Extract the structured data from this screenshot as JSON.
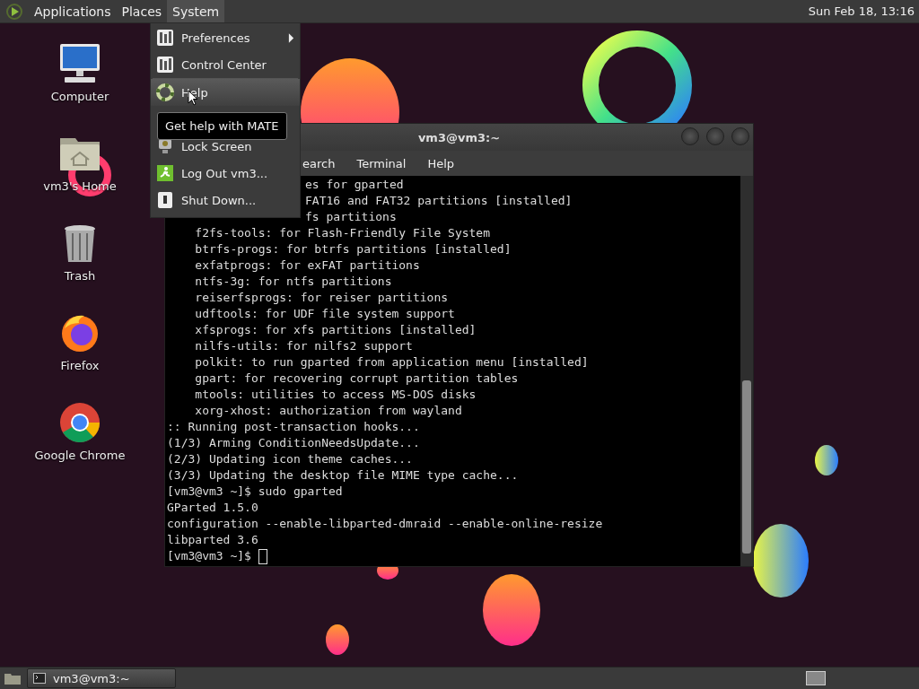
{
  "top_panel": {
    "menus": [
      {
        "label": "Applications",
        "selected": false
      },
      {
        "label": "Places",
        "selected": false
      },
      {
        "label": "System",
        "selected": true
      }
    ],
    "clock": "Sun Feb 18, 13:16"
  },
  "desktop_icons": [
    {
      "kind": "computer",
      "label": "Computer"
    },
    {
      "kind": "home",
      "label": "vm3's Home"
    },
    {
      "kind": "trash",
      "label": "Trash"
    },
    {
      "kind": "firefox",
      "label": "Firefox"
    },
    {
      "kind": "chrome",
      "label": "Google Chrome"
    }
  ],
  "system_menu": {
    "items": [
      {
        "kind": "prefs",
        "label": "Preferences",
        "submenu": true,
        "selected": false
      },
      {
        "kind": "prefs",
        "label": "Control Center",
        "submenu": false,
        "selected": false
      },
      {
        "kind": "help",
        "label": "Help",
        "submenu": false,
        "selected": true
      },
      {
        "kind": "lock",
        "label": "Lock Screen",
        "submenu": false,
        "selected": false
      },
      {
        "kind": "logout",
        "label": "Log Out vm3...",
        "submenu": false,
        "selected": false
      },
      {
        "kind": "shutdown",
        "label": "Shut Down...",
        "submenu": false,
        "selected": false
      }
    ]
  },
  "tooltip": "Get help with MATE",
  "terminal": {
    "title": "vm3@vm3:~",
    "menus": [
      "earch",
      "Terminal",
      "Help"
    ],
    "covered_lines": [
      "es for gparted",
      "FAT16 and FAT32 partitions [installed]",
      "fs partitions"
    ],
    "lines": [
      "    f2fs-tools: for Flash-Friendly File System",
      "    btrfs-progs: for btrfs partitions [installed]",
      "    exfatprogs: for exFAT partitions",
      "    ntfs-3g: for ntfs partitions",
      "    reiserfsprogs: for reiser partitions",
      "    udftools: for UDF file system support",
      "    xfsprogs: for xfs partitions [installed]",
      "    nilfs-utils: for nilfs2 support",
      "    polkit: to run gparted from application menu [installed]",
      "    gpart: for recovering corrupt partition tables",
      "    mtools: utilities to access MS-DOS disks",
      "    xorg-xhost: authorization from wayland",
      ":: Running post-transaction hooks...",
      "(1/3) Arming ConditionNeedsUpdate...",
      "(2/3) Updating icon theme caches...",
      "(3/3) Updating the desktop file MIME type cache...",
      "[vm3@vm3 ~]$ sudo gparted",
      "GParted 1.5.0",
      "configuration --enable-libparted-dmraid --enable-online-resize",
      "libparted 3.6"
    ],
    "prompt": "[vm3@vm3 ~]$"
  },
  "taskbar": {
    "tasks": [
      {
        "label": "vm3@vm3:~",
        "selected": false
      }
    ]
  }
}
